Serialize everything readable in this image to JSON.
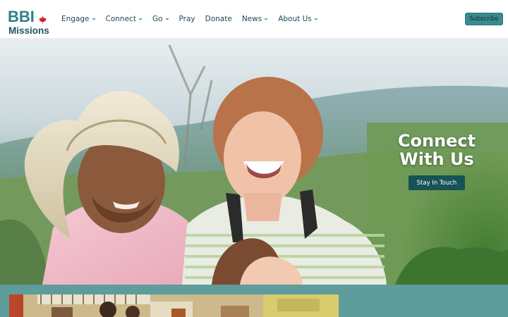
{
  "logo": {
    "line1": "BBI",
    "line2": "Missions"
  },
  "nav": {
    "items": [
      {
        "label": "Engage",
        "dropdown": true
      },
      {
        "label": "Connect",
        "dropdown": true
      },
      {
        "label": "Go",
        "dropdown": true
      },
      {
        "label": "Pray",
        "dropdown": false
      },
      {
        "label": "Donate",
        "dropdown": false
      },
      {
        "label": "News",
        "dropdown": true
      },
      {
        "label": "About Us",
        "dropdown": true
      }
    ],
    "subscribe_label": "Subscribe"
  },
  "hero": {
    "title_line1": "Connect",
    "title_line2": "With Us",
    "button_label": "Stay In Touch"
  },
  "colors": {
    "brand_teal": "#2f7f87",
    "button_dark_teal": "#165356",
    "band_teal": "#5f9c9c",
    "maple_red": "#d4202a"
  }
}
